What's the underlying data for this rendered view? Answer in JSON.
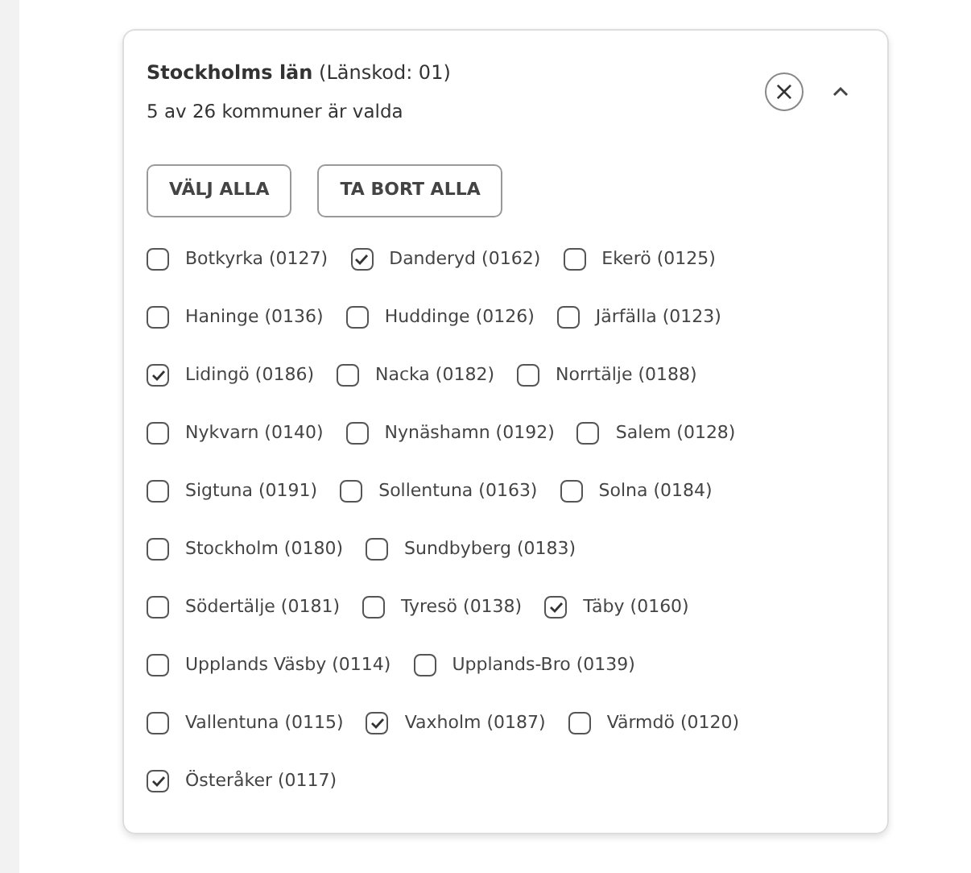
{
  "header": {
    "title": "**Stockholms län** (Länskod: 01)",
    "subtitle": "5 av 26 kommuner är valda",
    "clear_icon": "×",
    "expanded": true
  },
  "buttons": [
    "VÄLJ ALLA",
    "TA BORT ALLA"
  ],
  "rows": [
    [
      {
        "label": "Botkyrka (0127)",
        "checked": false
      },
      {
        "label": "Danderyd (0162)",
        "checked": true
      },
      {
        "label": "Ekerö (0125)",
        "checked": false
      }
    ],
    [
      {
        "label": "Haninge (0136)",
        "checked": false
      },
      {
        "label": "Huddinge (0126)",
        "checked": false
      },
      {
        "label": "Järfälla (0123)",
        "checked": false
      }
    ],
    [
      {
        "label": "Lidingö (0186)",
        "checked": true
      },
      {
        "label": "Nacka (0182)",
        "checked": false
      },
      {
        "label": "Norrtälje (0188)",
        "checked": false
      }
    ],
    [
      {
        "label": "Nykvarn (0140)",
        "checked": false
      },
      {
        "label": "Nynäshamn (0192)",
        "checked": false
      },
      {
        "label": "Salem (0128)",
        "checked": false
      }
    ],
    [
      {
        "label": "Sigtuna (0191)",
        "checked": false
      },
      {
        "label": "Sollentuna (0163)",
        "checked": false
      },
      {
        "label": "Solna (0184)",
        "checked": false
      }
    ],
    [
      {
        "label": "Stockholm (0180)",
        "checked": false
      },
      {
        "label": "Sundbyberg (0183)",
        "checked": false
      }
    ],
    [
      {
        "label": "Södertälje (0181)",
        "checked": false
      },
      {
        "label": "Tyresö (0138)",
        "checked": false
      },
      {
        "label": "Täby (0160)",
        "checked": true
      }
    ],
    [
      {
        "label": "Upplands Väsby (0114)",
        "checked": false
      },
      {
        "label": "Upplands-Bro (0139)",
        "checked": false
      }
    ],
    [
      {
        "label": "Vallentuna (0115)",
        "checked": false
      },
      {
        "label": "Vaxholm (0187)",
        "checked": true
      },
      {
        "label": "Värmdö (0120)",
        "checked": false
      }
    ],
    [
      {
        "label": "Österåker (0117)",
        "checked": true
      }
    ]
  ]
}
